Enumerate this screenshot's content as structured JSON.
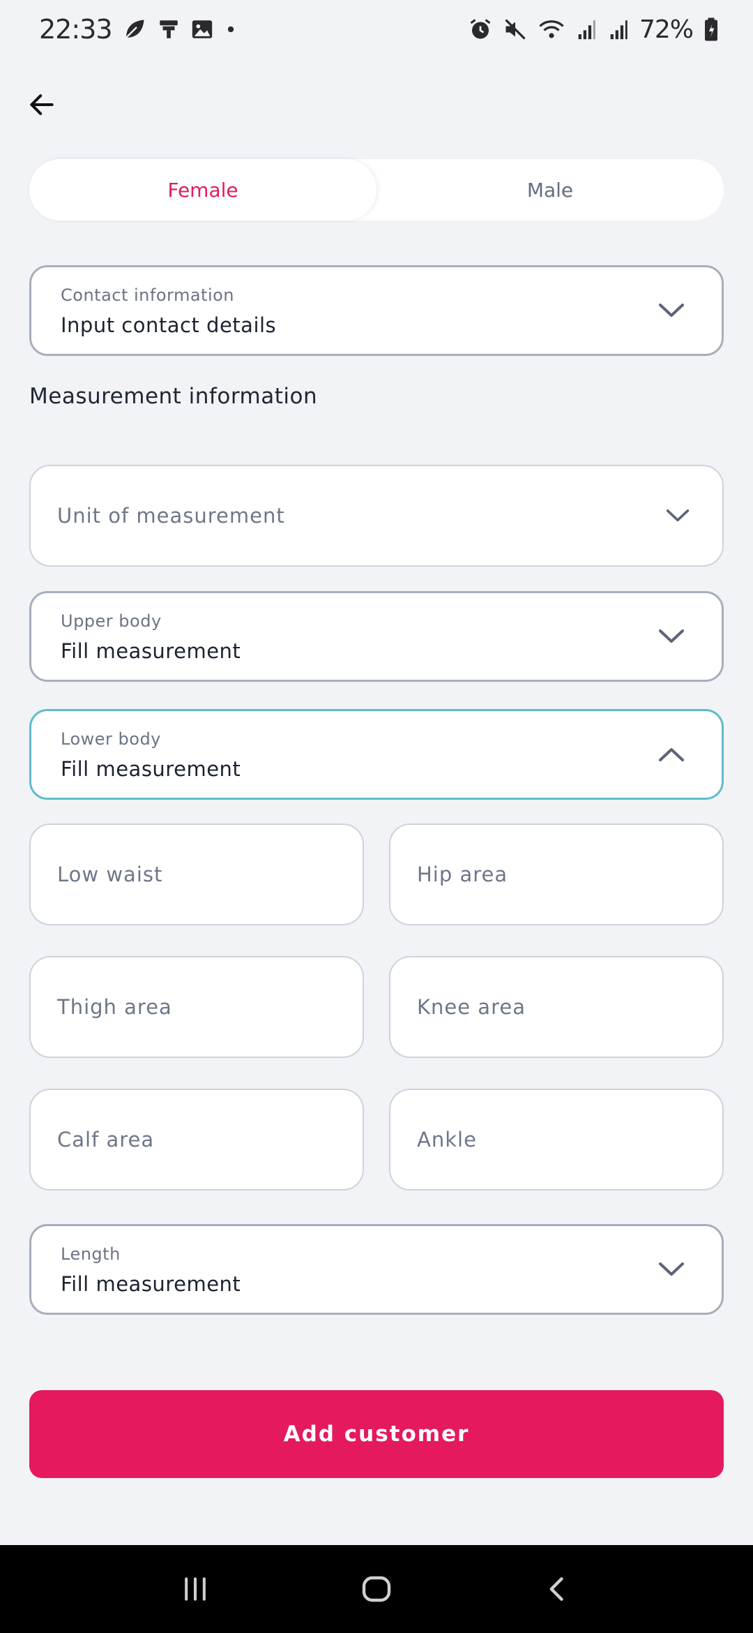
{
  "status_bar": {
    "time": "22:33",
    "battery": "72%",
    "left_icons": [
      "leaf-icon",
      "pin-icon",
      "image-icon",
      "dot-icon"
    ],
    "right_icons": [
      "alarm-icon",
      "mute-icon",
      "wifi-icon",
      "signal-icon",
      "signal-icon",
      "battery-icon"
    ]
  },
  "gender": {
    "options": [
      "Female",
      "Male"
    ],
    "selected": "Female",
    "active_color": "#e5195e"
  },
  "contact": {
    "label": "Contact information",
    "value": "Input contact details"
  },
  "measurement": {
    "section_title": "Measurement information",
    "unit_placeholder": "Unit of measurement",
    "upper_body": {
      "label": "Upper body",
      "value": "Fill measurement"
    },
    "lower_body": {
      "label": "Lower body",
      "value": "Fill measurement",
      "expanded": true,
      "fields": [
        "Low waist",
        "Hip area",
        "Thigh area",
        "Knee area",
        "Calf area",
        "Ankle"
      ]
    },
    "length": {
      "label": "Length",
      "value": "Fill measurement"
    }
  },
  "actions": {
    "add_customer": "Add customer",
    "accent": "#e5195e",
    "focus_border": "#5fbcca"
  }
}
